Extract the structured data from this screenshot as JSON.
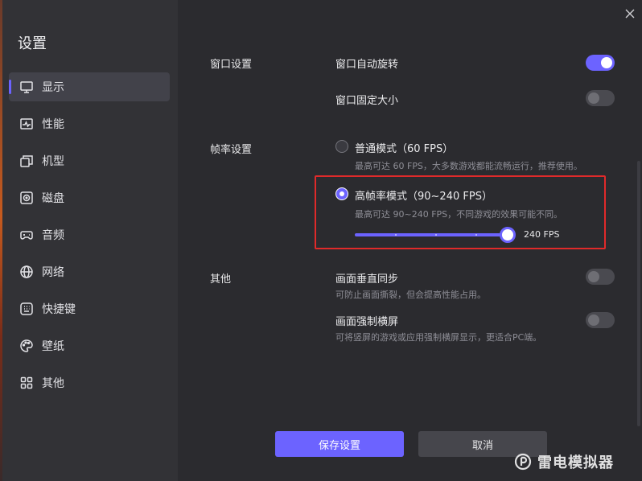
{
  "sidebar": {
    "title": "设置",
    "items": [
      {
        "label": "显示",
        "icon": "monitor-icon",
        "active": true
      },
      {
        "label": "性能",
        "icon": "pulse-icon",
        "active": false
      },
      {
        "label": "机型",
        "icon": "device-icon",
        "active": false
      },
      {
        "label": "磁盘",
        "icon": "disk-icon",
        "active": false
      },
      {
        "label": "音频",
        "icon": "gamepad-icon",
        "active": false
      },
      {
        "label": "网络",
        "icon": "globe-icon",
        "active": false
      },
      {
        "label": "快捷键",
        "icon": "keyboard-icon",
        "active": false
      },
      {
        "label": "壁纸",
        "icon": "palette-icon",
        "active": false
      },
      {
        "label": "其他",
        "icon": "grid-icon",
        "active": false
      }
    ]
  },
  "window": {
    "section": {
      "label": "窗口设置"
    },
    "auto_rotate": {
      "label": "窗口自动旋转",
      "on": true
    },
    "fixed_size": {
      "label": "窗口固定大小",
      "on": false
    }
  },
  "framerate": {
    "section": {
      "label": "帧率设置"
    },
    "normal": {
      "label": "普通模式（60 FPS）",
      "desc": "最高可达 60 FPS，大多数游戏都能流畅运行，推荐使用。",
      "checked": false
    },
    "high": {
      "label": "高帧率模式（90~240 FPS）",
      "desc": "最高可达 90~240 FPS，不同游戏的效果可能不同。",
      "checked": true
    },
    "slider": {
      "value_label": "240 FPS",
      "value": 240,
      "min": 90,
      "max": 240
    }
  },
  "other": {
    "section": {
      "label": "其他"
    },
    "vsync": {
      "label": "画面垂直同步",
      "desc": "可防止画面撕裂，但会提高性能占用。",
      "on": false
    },
    "force_landscape": {
      "label": "画面强制横屏",
      "desc": "可将竖屏的游戏或应用强制横屏显示，更适合PC端。",
      "on": false
    }
  },
  "buttons": {
    "save": "保存设置",
    "cancel": "取消"
  },
  "watermark": {
    "text": "雷电模拟器"
  },
  "colors": {
    "accent": "#6c63ff",
    "highlight": "#e02a2a"
  }
}
